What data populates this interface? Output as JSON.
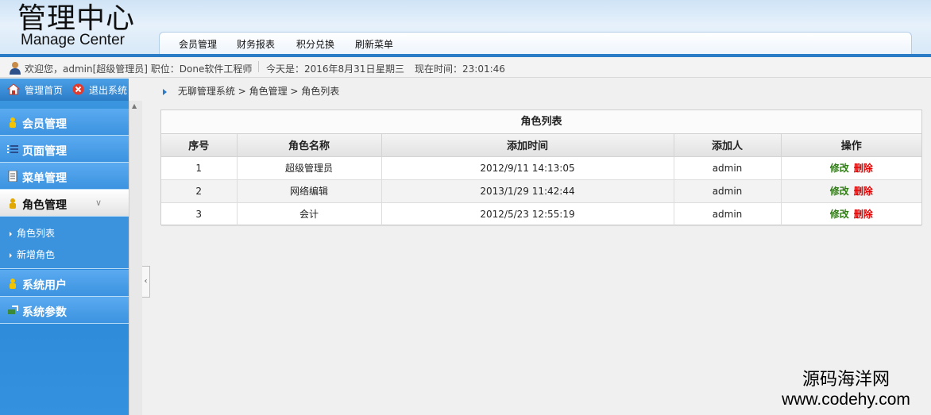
{
  "header": {
    "logo_cn": "管理中心",
    "logo_en": "Manage Center",
    "nav": [
      "会员管理",
      "财务报表",
      "积分兑换",
      "刷新菜单"
    ]
  },
  "infobar": {
    "welcome": "欢迎您，admin[超级管理员] 职位：Done软件工程师",
    "today": "今天是：2016年8月31日",
    "weekday": "星期三",
    "time": "现在时间：23:01:46"
  },
  "sidebar": {
    "home": "管理首页",
    "exit": "退出系统",
    "items": [
      {
        "label": "会员管理",
        "icon": "member-icon"
      },
      {
        "label": "页面管理",
        "icon": "list-icon"
      },
      {
        "label": "菜单管理",
        "icon": "document-icon"
      },
      {
        "label": "角色管理",
        "icon": "role-icon"
      },
      {
        "label": "系统用户",
        "icon": "user-icon"
      },
      {
        "label": "系统参数",
        "icon": "settings-icon"
      }
    ],
    "submenu": [
      "角色列表",
      "新增角色"
    ]
  },
  "breadcrumb": {
    "root": "无聊管理系统",
    "section": "角色管理",
    "current": "角色列表",
    "separator": ">"
  },
  "panel": {
    "title": "角色列表",
    "columns": [
      "序号",
      "角色名称",
      "添加时间",
      "添加人",
      "操作"
    ],
    "rows": [
      {
        "id": "1",
        "name": "超级管理员",
        "time": "2012/9/11 14:13:05",
        "by": "admin",
        "edit": "修改",
        "del": "删除"
      },
      {
        "id": "2",
        "name": "网络编辑",
        "time": "2013/1/29 11:42:44",
        "by": "admin",
        "edit": "修改",
        "del": "删除"
      },
      {
        "id": "3",
        "name": "会计",
        "time": "2012/5/23 12:55:19",
        "by": "admin",
        "edit": "修改",
        "del": "删除"
      }
    ]
  },
  "watermark": {
    "line1": "源码海洋网",
    "line2": "www.codehy.com"
  },
  "colors": {
    "accent": "#2b7cc7",
    "edit": "#2e7d12",
    "delete": "#e00000"
  }
}
